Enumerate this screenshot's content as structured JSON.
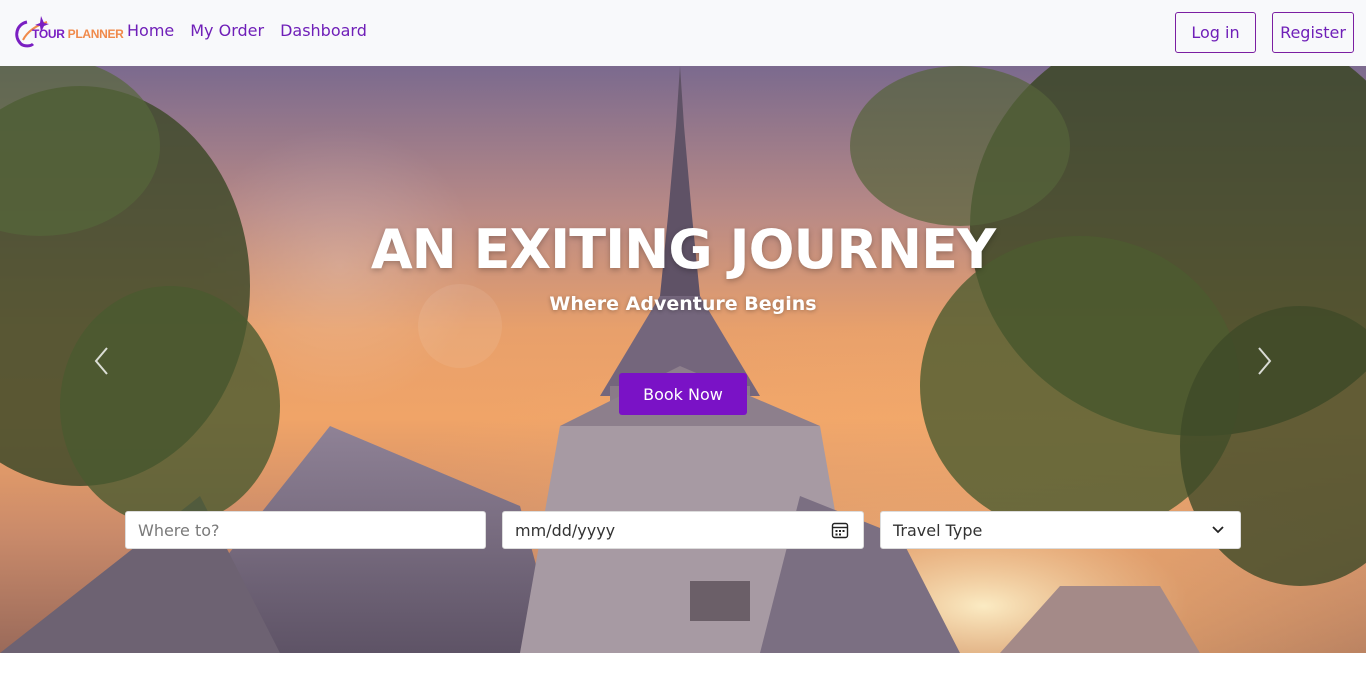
{
  "brand": {
    "logo_tour": "TOUR",
    "logo_planner": "PLANNER",
    "colors": {
      "accent": "#7a12c6",
      "logo_orange": "#f08a4b"
    }
  },
  "nav": {
    "links": [
      {
        "label": "Home"
      },
      {
        "label": "My Order"
      },
      {
        "label": "Dashboard"
      }
    ],
    "login_label": "Log in",
    "register_label": "Register"
  },
  "hero": {
    "title": "AN EXITING JOURNEY",
    "subtitle": "Where Adventure Begins",
    "cta_label": "Book Now",
    "prev_icon": "chevron-left-icon",
    "next_icon": "chevron-right-icon"
  },
  "search": {
    "destination_placeholder": "Where to?",
    "date_value": "mm/dd/yyyy",
    "travel_type_value": "Travel Type"
  }
}
